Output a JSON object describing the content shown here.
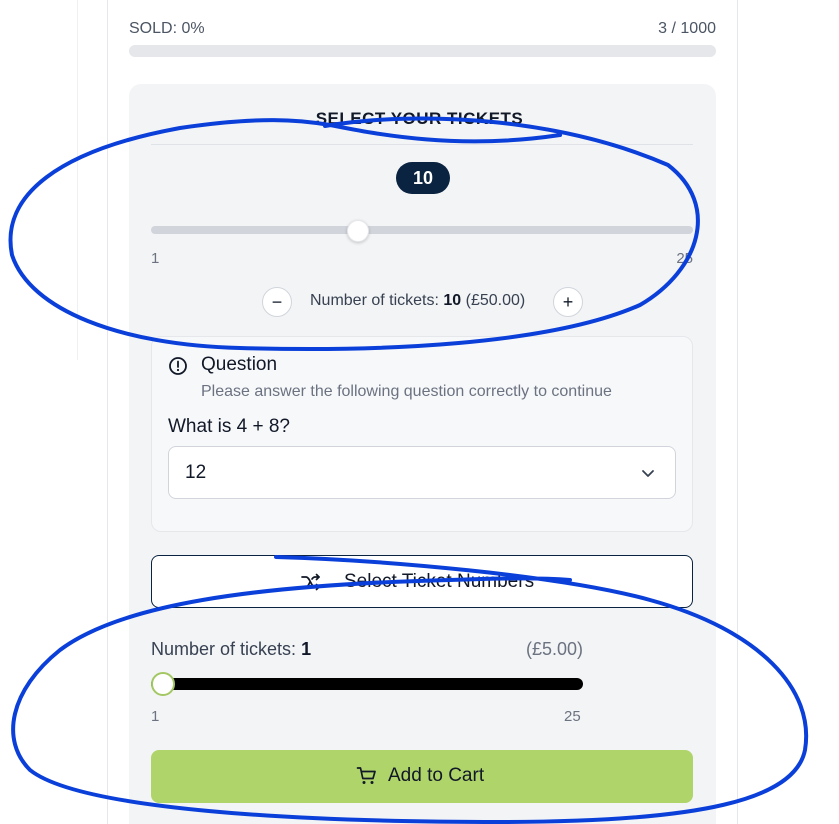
{
  "progress": {
    "sold_label": "SOLD: 0%",
    "sold_count": "3 / 1000",
    "fill_fraction": 0.0
  },
  "ticket_selector": {
    "title": "SELECT YOUR TICKETS",
    "badge": "10",
    "slider": {
      "min": 1,
      "max": 25,
      "value": 10,
      "min_label": "1",
      "max_label": "25"
    },
    "decrement": "−",
    "increment": "+",
    "count_prefix": "Number of tickets:",
    "count_value": "10",
    "count_price": "(£50.00)"
  },
  "question": {
    "icon": "alert-circle-icon",
    "title": "Question",
    "subtitle": "Please answer the following question correctly to continue",
    "text": "What is 4 + 8?",
    "selected_answer": "12"
  },
  "select_numbers_button": {
    "icon": "shuffle-icon",
    "label": "Select Ticket Numbers"
  },
  "ticket_selector_2": {
    "count_prefix": "Number of tickets:",
    "count_value": "1",
    "price": "(£5.00)",
    "slider": {
      "min": 1,
      "max": 25,
      "value": 1,
      "min_label": "1",
      "max_label": "25"
    }
  },
  "cart_button": {
    "icon": "cart-icon",
    "label": "Add to Cart"
  },
  "colors": {
    "navy": "#0a2340",
    "green": "#afd46a",
    "annotation_blue": "#0b3fd9"
  }
}
